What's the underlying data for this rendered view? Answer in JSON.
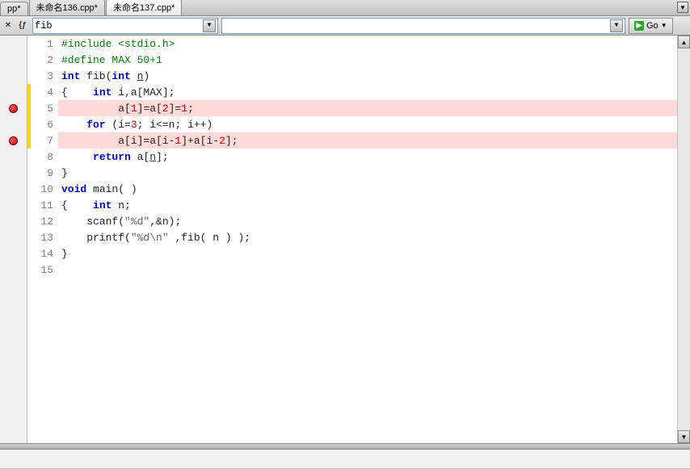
{
  "tabs": [
    {
      "label": "pp*"
    },
    {
      "label": "未命名136.cpp*"
    },
    {
      "label": "未命名137.cpp*"
    }
  ],
  "active_tab": 2,
  "toolbar": {
    "func_combo_value": "fib",
    "nav_combo_value": "",
    "go_label": "Go"
  },
  "editor": {
    "lines": [
      {
        "n": 1,
        "bp": false,
        "changed": false,
        "hl": false,
        "tokens": [
          [
            "pp",
            "#include <stdio.h>"
          ]
        ]
      },
      {
        "n": 2,
        "bp": false,
        "changed": false,
        "hl": false,
        "tokens": [
          [
            "pp",
            "#define MAX 50+1"
          ]
        ]
      },
      {
        "n": 3,
        "bp": false,
        "changed": false,
        "hl": false,
        "tokens": [
          [
            "kw",
            "int"
          ],
          [
            "plain",
            " fib("
          ],
          [
            "kw",
            "int"
          ],
          [
            "plain",
            " "
          ],
          [
            "underline",
            "n"
          ],
          [
            "plain",
            ")"
          ]
        ]
      },
      {
        "n": 4,
        "bp": false,
        "changed": true,
        "hl": false,
        "tokens": [
          [
            "plain",
            "{    "
          ],
          [
            "kw",
            "int"
          ],
          [
            "plain",
            " i,a[MAX];"
          ]
        ]
      },
      {
        "n": 5,
        "bp": true,
        "changed": true,
        "hl": true,
        "tokens": [
          [
            "plain",
            "         a["
          ],
          [
            "num",
            "1"
          ],
          [
            "plain",
            "]=a["
          ],
          [
            "num",
            "2"
          ],
          [
            "plain",
            "]="
          ],
          [
            "num",
            "1"
          ],
          [
            "plain",
            ";"
          ]
        ]
      },
      {
        "n": 6,
        "bp": false,
        "changed": true,
        "hl": false,
        "tokens": [
          [
            "plain",
            "    "
          ],
          [
            "kw",
            "for"
          ],
          [
            "plain",
            " (i="
          ],
          [
            "num",
            "3"
          ],
          [
            "plain",
            "; i<=n; i++)"
          ]
        ]
      },
      {
        "n": 7,
        "bp": true,
        "changed": true,
        "hl": true,
        "tokens": [
          [
            "plain",
            "         a[i]=a[i-"
          ],
          [
            "num",
            "1"
          ],
          [
            "plain",
            "]+a[i-"
          ],
          [
            "num",
            "2"
          ],
          [
            "plain",
            "];"
          ]
        ]
      },
      {
        "n": 8,
        "bp": false,
        "changed": false,
        "hl": false,
        "tokens": [
          [
            "plain",
            "     "
          ],
          [
            "kw",
            "return"
          ],
          [
            "plain",
            " a["
          ],
          [
            "underline",
            "n"
          ],
          [
            "plain",
            "];"
          ]
        ]
      },
      {
        "n": 9,
        "bp": false,
        "changed": false,
        "hl": false,
        "tokens": [
          [
            "plain",
            "}"
          ]
        ]
      },
      {
        "n": 10,
        "bp": false,
        "changed": false,
        "hl": false,
        "tokens": [
          [
            "kw",
            "void"
          ],
          [
            "plain",
            " main( )"
          ]
        ]
      },
      {
        "n": 11,
        "bp": false,
        "changed": false,
        "hl": false,
        "tokens": [
          [
            "plain",
            "{    "
          ],
          [
            "kw",
            "int"
          ],
          [
            "plain",
            " n;"
          ]
        ]
      },
      {
        "n": 12,
        "bp": false,
        "changed": false,
        "hl": false,
        "tokens": [
          [
            "plain",
            "    scanf("
          ],
          [
            "str",
            "\"%d\""
          ],
          [
            "plain",
            ",&n);"
          ]
        ]
      },
      {
        "n": 13,
        "bp": false,
        "changed": false,
        "hl": false,
        "tokens": [
          [
            "plain",
            "    printf("
          ],
          [
            "str",
            "\"%d\\n\""
          ],
          [
            "plain",
            " ,fib( n ) );"
          ]
        ]
      },
      {
        "n": 14,
        "bp": false,
        "changed": false,
        "hl": false,
        "tokens": [
          [
            "plain",
            "}"
          ]
        ]
      },
      {
        "n": 15,
        "bp": false,
        "changed": false,
        "hl": false,
        "tokens": [
          [
            "plain",
            ""
          ]
        ]
      }
    ]
  },
  "status_text": ""
}
